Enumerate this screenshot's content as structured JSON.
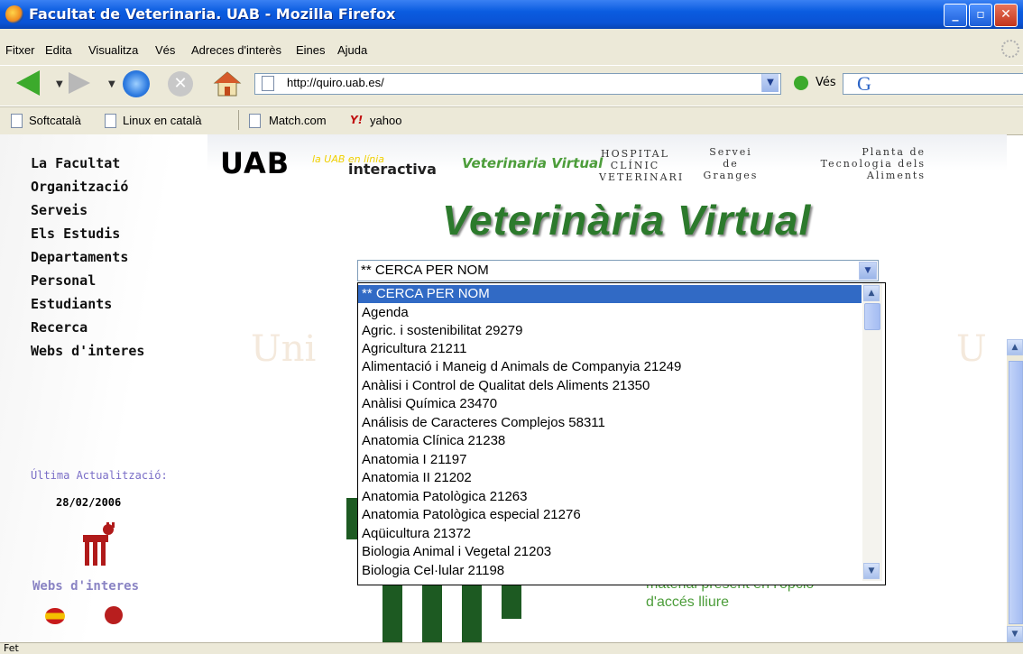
{
  "window": {
    "title": "Facultat de Veterinaria. UAB - Mozilla Firefox"
  },
  "menu": [
    "Fitxer",
    "Edita",
    "Visualitza",
    "Vés",
    "Adreces d'interès",
    "Eines",
    "Ajuda"
  ],
  "nav": {
    "url": "http://quiro.uab.es/",
    "go_label": "Vés"
  },
  "bookmarks": [
    "Softcatalà",
    "Linux en català",
    "Match.com",
    "yahoo"
  ],
  "left_nav": [
    "La Facultat",
    "Organització",
    "Serveis",
    "Els Estudis",
    "Departaments",
    "Personal",
    "Estudiants",
    "Recerca",
    "Webs d'interes"
  ],
  "header": {
    "uab": "UAB",
    "interactiva_small": "la UAB en línia",
    "interactiva": "interactiva",
    "vv_small": "Veterinaria Virtual",
    "hospital": [
      "HOSPITAL",
      "CLÍNIC",
      "VETERINARI"
    ],
    "servei": [
      "Servei",
      "de",
      "Granges"
    ],
    "planta": [
      "Planta de",
      "Tecnologia dels",
      "Aliments"
    ],
    "big_title": "Veterinària Virtual"
  },
  "sidebar_footer": {
    "last_update_label": "Última Actualització:",
    "last_update_date": "28/02/2006",
    "webs_label": "Webs d'interes"
  },
  "select": {
    "value": "** CERCA PER NOM",
    "options": [
      "** CERCA PER NOM",
      "Agenda",
      "Agric. i sostenibilitat 29279",
      "Agricultura 21211",
      "Alimentació i Maneig d Animals de Companyia 21249",
      "Anàlisi i Control de Qualitat dels Aliments 21350",
      "Anàlisi Química 23470",
      "Análisis de Caracteres Complejos 58311",
      "Anatomia Clínica 21238",
      "Anatomia I 21197",
      "Anatomia II 21202",
      "Anatomia Patològica 21263",
      "Anatomia Patològica especial 21276",
      "Aqüicultura 21372",
      "Biologia Animal i Vegetal 21203",
      "Biologia Cel·lular 21198"
    ]
  },
  "page_text": {
    "access_line1": "material present en l'opció",
    "access_line2": "d'accés lliure"
  },
  "watermark": {
    "left": "Uni",
    "right": "U"
  },
  "status": {
    "text": "Fet"
  }
}
